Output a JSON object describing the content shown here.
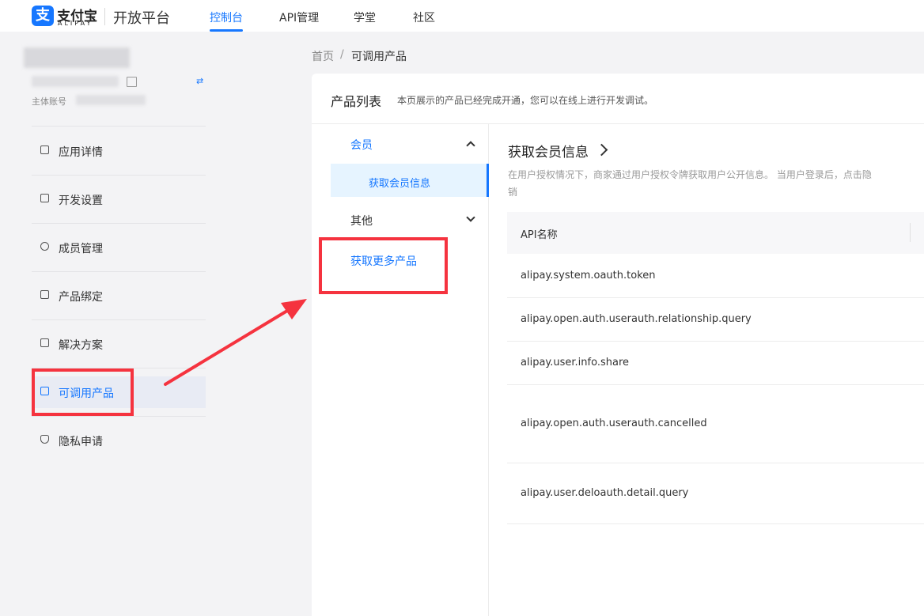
{
  "header": {
    "logo_mark": "支",
    "logo_cn": "支付宝",
    "logo_en": "ALIPAY",
    "platform": "开放平台",
    "nav": [
      "控制台",
      "API管理",
      "学堂",
      "社区"
    ],
    "active_nav": 0
  },
  "sidebar": {
    "account_label": "主体账号",
    "items": [
      {
        "label": "应用详情",
        "icon": "chart-icon"
      },
      {
        "label": "开发设置",
        "icon": "settings-doc-icon"
      },
      {
        "label": "成员管理",
        "icon": "users-icon"
      },
      {
        "label": "产品绑定",
        "icon": "link-icon"
      },
      {
        "label": "解决方案",
        "icon": "book-icon"
      },
      {
        "label": "可调用产品",
        "icon": "product-icon"
      },
      {
        "label": "隐私申请",
        "icon": "shield-icon"
      }
    ],
    "active_index": 5
  },
  "breadcrumb": {
    "home": "首页",
    "separator": "/",
    "current": "可调用产品"
  },
  "panel": {
    "title": "产品列表",
    "description": "本页展示的产品已经完成开通，您可以在线上进行开发调试。"
  },
  "product_menu": {
    "groups": [
      {
        "label": "会员",
        "expanded": true,
        "children": [
          "获取会员信息"
        ]
      },
      {
        "label": "其他",
        "expanded": false,
        "children": []
      }
    ],
    "more_link": "获取更多产品"
  },
  "product_detail": {
    "title": "获取会员信息",
    "description_line1": "在用户授权情况下，商家通过用户授权令牌获取用户公开信息。 当用户登录后，点击隐",
    "description_line2": "销",
    "table_header": "API名称",
    "apis": [
      "alipay.system.oauth.token",
      "alipay.open.auth.userauth.relationship.query",
      "alipay.user.info.share",
      "alipay.open.auth.userauth.cancelled",
      "alipay.user.deloauth.detail.query"
    ]
  },
  "colors": {
    "brand": "#1677ff",
    "annotation": "#f5333f"
  }
}
